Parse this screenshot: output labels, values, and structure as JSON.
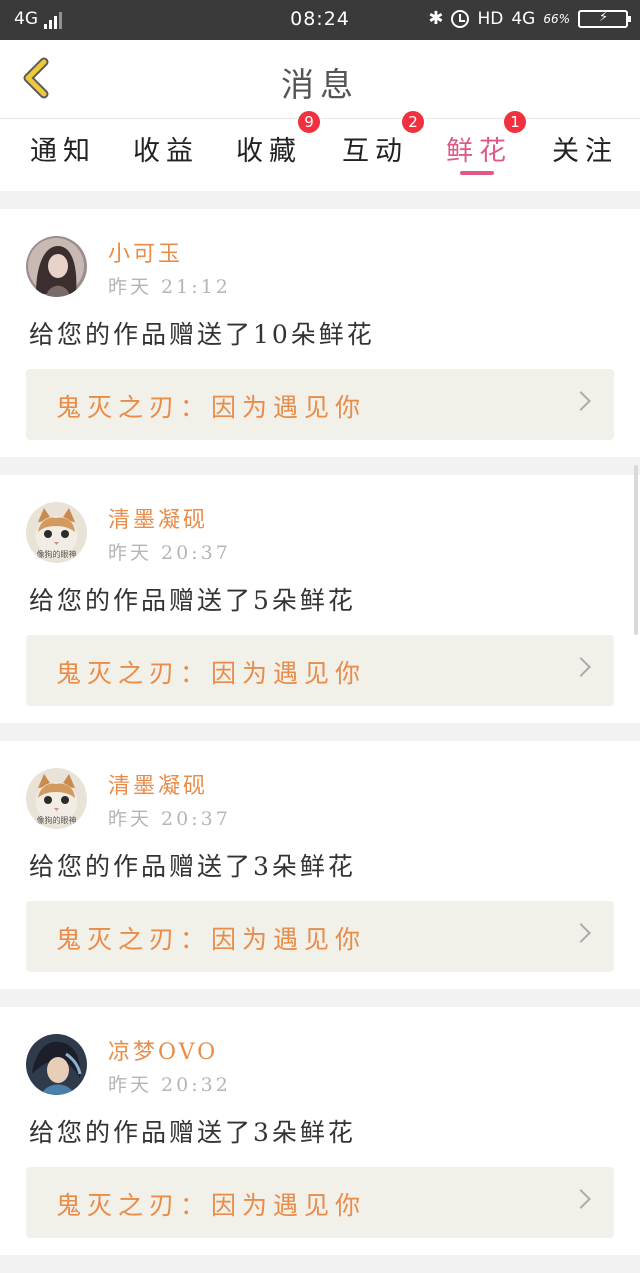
{
  "status_bar": {
    "network_left": "4G",
    "time": "08:24",
    "hd": "HD",
    "network_right": "4G",
    "battery_pct": "66%",
    "bluetooth_icon": "bluetooth-icon",
    "alarm_icon": "alarm-icon",
    "battery_icon": "battery-charging-icon"
  },
  "header": {
    "title": "消息",
    "back_icon": "chevron-left-icon",
    "back_color": "#f0c93a"
  },
  "tabs": [
    {
      "label": "通知",
      "badge": null,
      "active": false
    },
    {
      "label": "收益",
      "badge": null,
      "active": false
    },
    {
      "label": "收藏",
      "badge": "9",
      "active": false
    },
    {
      "label": "互动",
      "badge": "2",
      "active": false
    },
    {
      "label": "鲜花",
      "badge": "1",
      "active": true
    },
    {
      "label": "关注",
      "badge": null,
      "active": false
    }
  ],
  "colors": {
    "accent_pink": "#e0588a",
    "username_orange": "#e98c4a",
    "badge_red": "#f0313f",
    "work_link_bg": "#f1f0e9"
  },
  "messages": [
    {
      "username": "小可玉",
      "time": "昨天 21:12",
      "text": "给您的作品赠送了10朵鲜花",
      "work": "鬼灭之刃：因为遇见你",
      "avatar": "avatar-girl"
    },
    {
      "username": "清墨凝砚",
      "time": "昨天 20:37",
      "text": "给您的作品赠送了5朵鲜花",
      "work": "鬼灭之刃：因为遇见你",
      "avatar": "avatar-cat",
      "avatar_caption": "像狗的眼神"
    },
    {
      "username": "清墨凝砚",
      "time": "昨天 20:37",
      "text": "给您的作品赠送了3朵鲜花",
      "work": "鬼灭之刃：因为遇见你",
      "avatar": "avatar-cat",
      "avatar_caption": "像狗的眼神"
    },
    {
      "username": "凉梦OVO",
      "time": "昨天 20:32",
      "text": "给您的作品赠送了3朵鲜花",
      "work": "鬼灭之刃：因为遇见你",
      "avatar": "avatar-anime"
    }
  ]
}
